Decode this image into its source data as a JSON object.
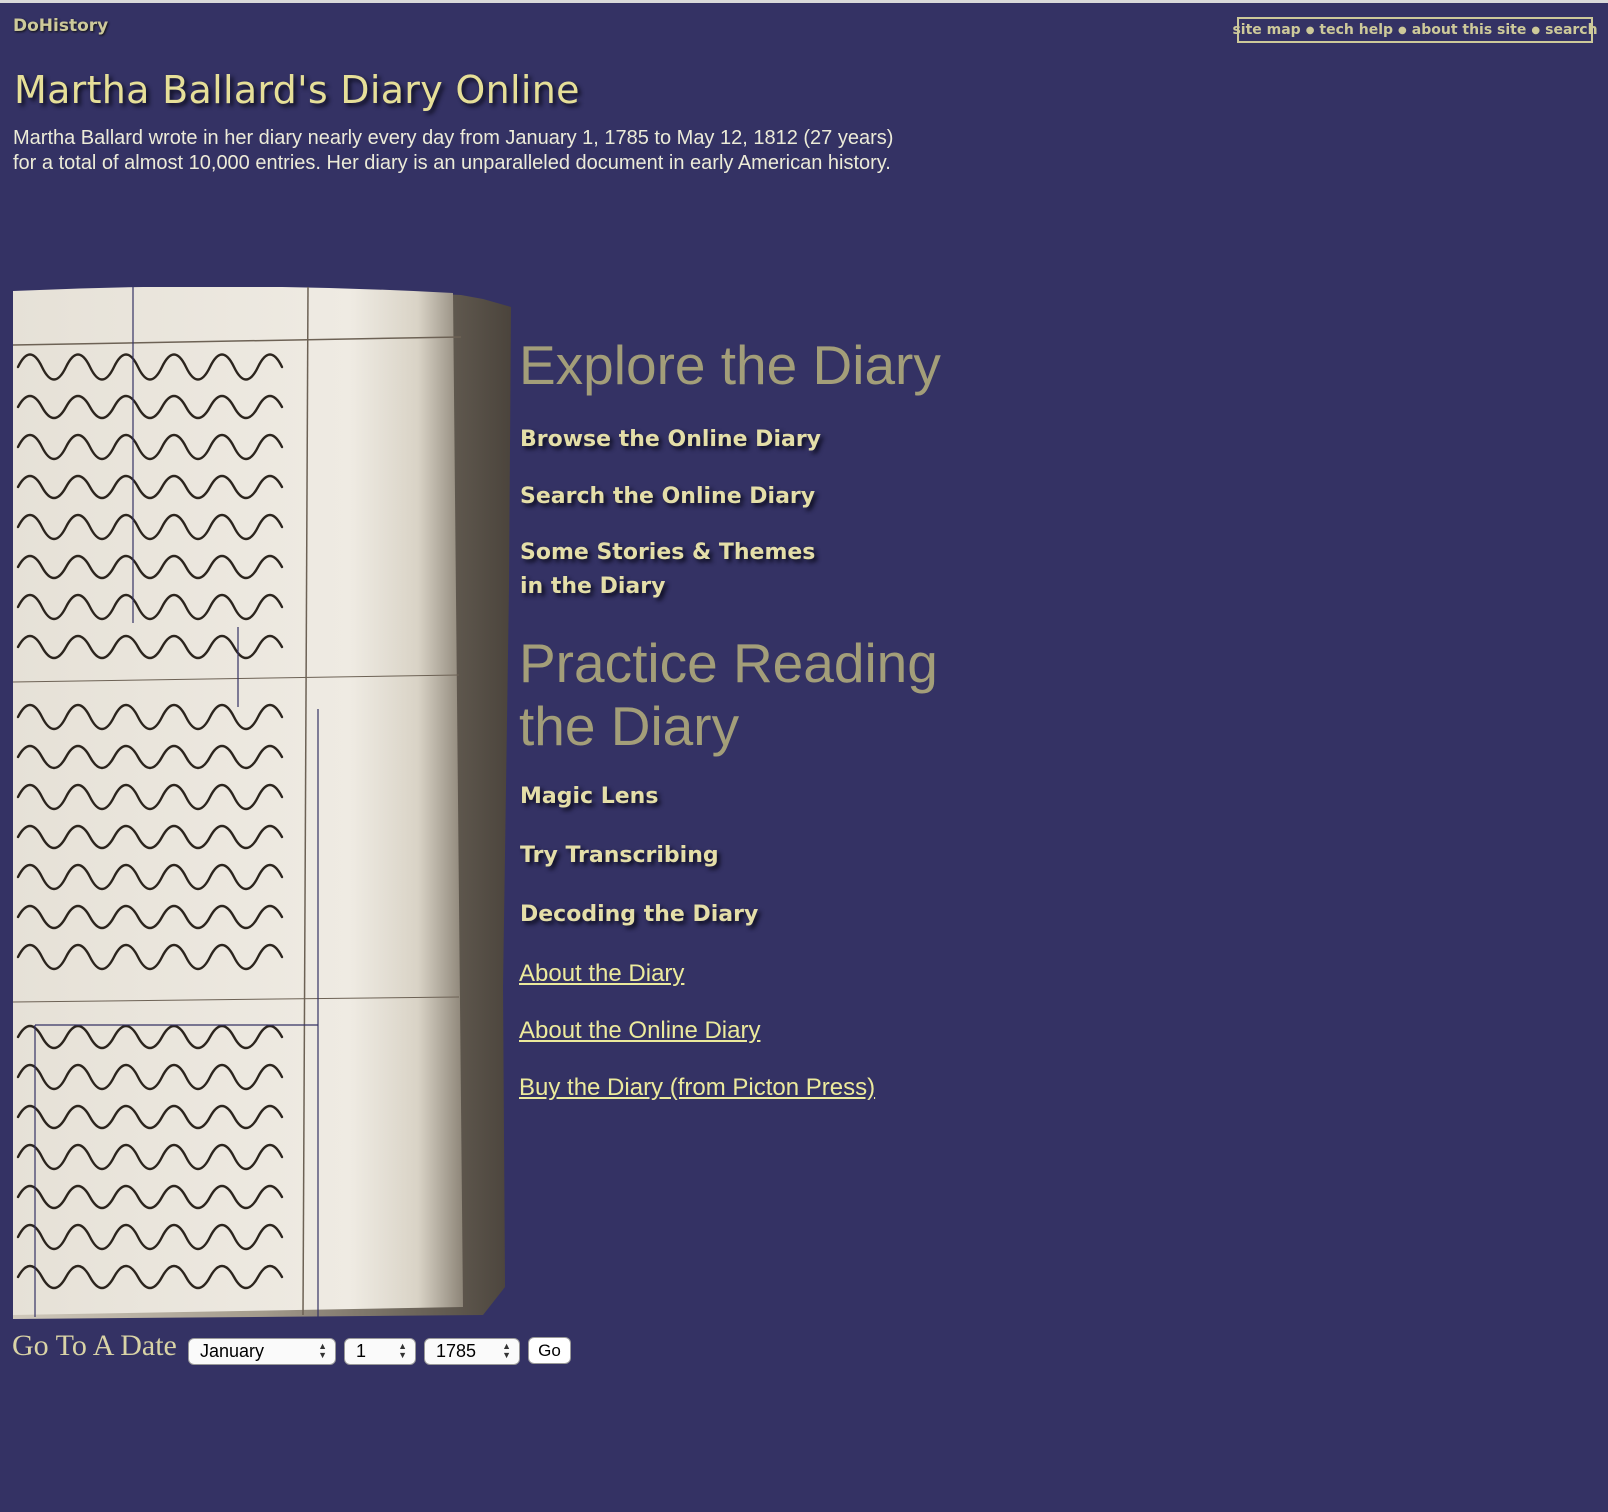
{
  "site": {
    "name": "DoHistory"
  },
  "topnav": {
    "items": [
      "site map",
      "tech help",
      "about this site",
      "search"
    ]
  },
  "header": {
    "title": "Martha Ballard's Diary Online",
    "intro_line1": "Martha Ballard wrote in her diary nearly every day from January 1, 1785 to May 12, 1812 (27 years)",
    "intro_line2": "for a total of almost 10,000 entries. Her diary is an unparalleled document in early American history."
  },
  "explore": {
    "title": "Explore the Diary",
    "links": [
      "Browse the Online Diary",
      "Search the Online Diary",
      "Some Stories & Themes",
      "in the Diary"
    ]
  },
  "practice": {
    "title": "Practice Reading the Diary",
    "links": [
      "Magic Lens",
      "Try Transcribing",
      "Decoding the Diary"
    ]
  },
  "text_links": [
    "About the Diary",
    "About the Online Diary",
    "Buy the Diary (from Picton Press)"
  ],
  "goto": {
    "label": "Go To A Date",
    "month": "January",
    "day": "1",
    "year": "1785",
    "button": "Go"
  }
}
